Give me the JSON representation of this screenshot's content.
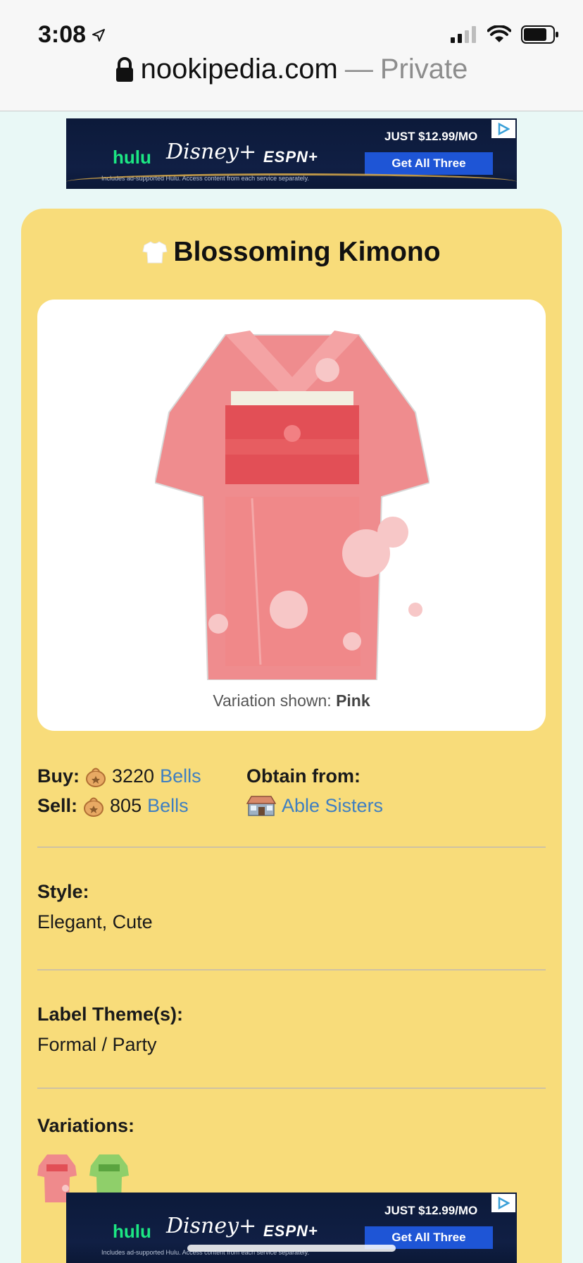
{
  "status": {
    "time": "3:08"
  },
  "url_bar": {
    "domain": "nookipedia.com",
    "separator": "—",
    "mode": "Private"
  },
  "ad": {
    "hulu": "hulu",
    "disney": "Disney+",
    "espn": "ESPN+",
    "price": "JUST $12.99/MO",
    "cta": "Get All Three",
    "fine_print": "Includes ad-supported Hulu. Access content from each service separately."
  },
  "item": {
    "title": "Blossoming Kimono",
    "variation_label": "Variation shown:",
    "variation_value": "Pink",
    "buy_label": "Buy:",
    "buy_value": "3220",
    "sell_label": "Sell:",
    "sell_value": "805",
    "currency": "Bells",
    "obtain_label": "Obtain from:",
    "obtain_source": "Able Sisters",
    "style_label": "Style:",
    "style_value": "Elegant, Cute",
    "label_theme_label": "Label Theme(s):",
    "label_theme_value": "Formal / Party",
    "variations_label": "Variations:",
    "variations": [
      "Pink",
      "Green"
    ]
  },
  "colors": {
    "card_bg": "#f8dc7a",
    "link": "#3f7fc1",
    "page_bg": "#e9f8f6",
    "kimono_pink": "#ef8a8c",
    "kimono_green": "#8fcf6a"
  }
}
